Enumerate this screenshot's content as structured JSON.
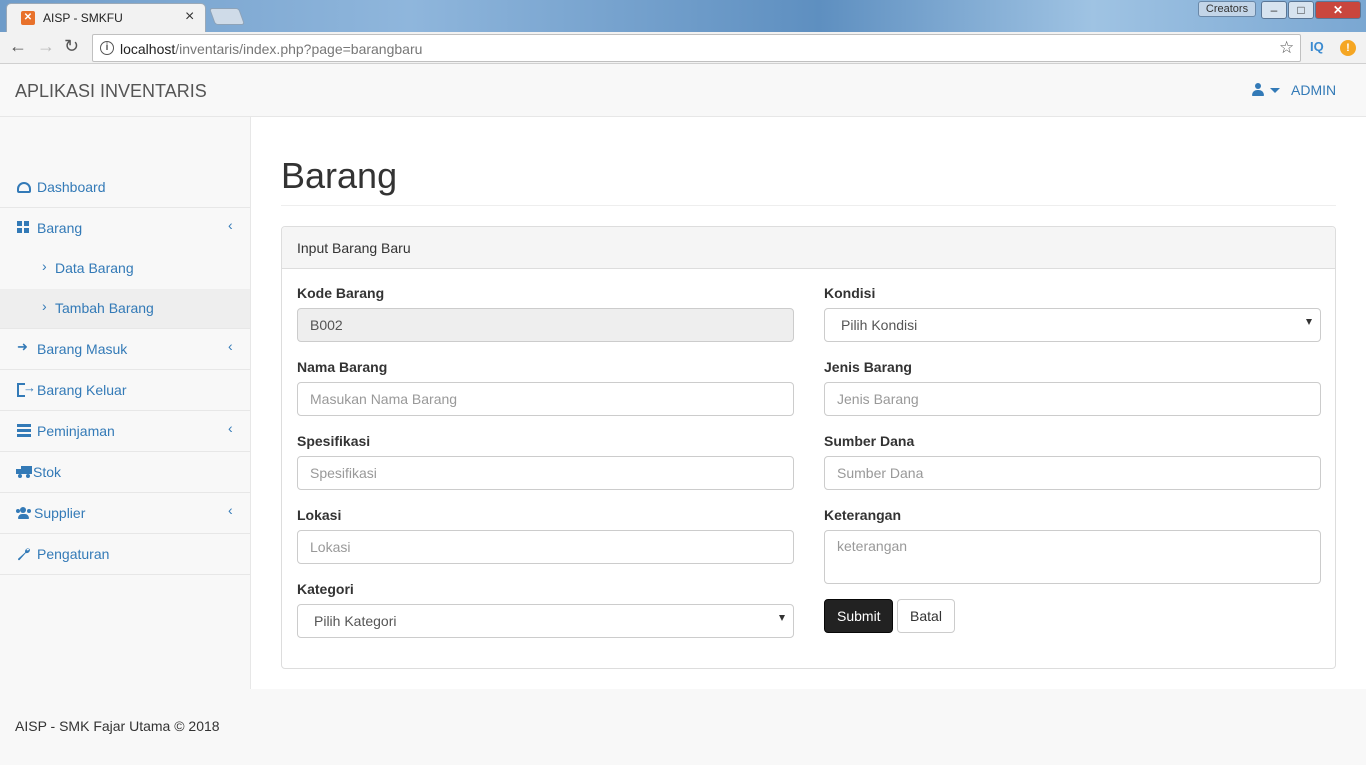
{
  "browser": {
    "tab_title": "AISP - SMKFU",
    "tab_close": "×",
    "creators_label": "Creators",
    "win_min": "–",
    "win_max": "□",
    "win_close": "✕",
    "url_host": "localhost",
    "url_path": "/inventaris/index.php?page=barangbaru",
    "ext_iq": "IQ",
    "ext_warn": "!"
  },
  "navbar": {
    "brand": "APLIKASI INVENTARIS",
    "user_label": "ADMIN"
  },
  "sidebar": {
    "items": [
      {
        "label": "Dashboard"
      },
      {
        "label": "Barang"
      },
      {
        "label": "Data Barang"
      },
      {
        "label": "Tambah Barang"
      },
      {
        "label": "Barang Masuk"
      },
      {
        "label": "Barang Keluar"
      },
      {
        "label": "Peminjaman"
      },
      {
        "label": "Stok"
      },
      {
        "label": "Supplier"
      },
      {
        "label": "Pengaturan"
      }
    ]
  },
  "main": {
    "title": "Barang",
    "panel_heading": "Input Barang Baru",
    "fields": {
      "kode": {
        "label": "Kode Barang",
        "value": "B002"
      },
      "nama": {
        "label": "Nama Barang",
        "placeholder": "Masukan Nama Barang"
      },
      "spesifikasi": {
        "label": "Spesifikasi",
        "placeholder": "Spesifikasi"
      },
      "lokasi": {
        "label": "Lokasi",
        "placeholder": "Lokasi"
      },
      "kategori": {
        "label": "Kategori",
        "selected": "Pilih Kategori"
      },
      "kondisi": {
        "label": "Kondisi",
        "selected": "Pilih Kondisi"
      },
      "jenis": {
        "label": "Jenis Barang",
        "placeholder": "Jenis Barang"
      },
      "sumber": {
        "label": "Sumber Dana",
        "placeholder": "Sumber Dana"
      },
      "keterangan": {
        "label": "Keterangan",
        "placeholder": "keterangan"
      }
    },
    "submit_label": "Submit",
    "cancel_label": "Batal"
  },
  "footer": {
    "text": "AISP - SMK Fajar Utama © 2018"
  },
  "colors": {
    "link": "#337ab7",
    "submit_bg": "#222222",
    "panel_heading_bg": "#f5f5f5"
  }
}
